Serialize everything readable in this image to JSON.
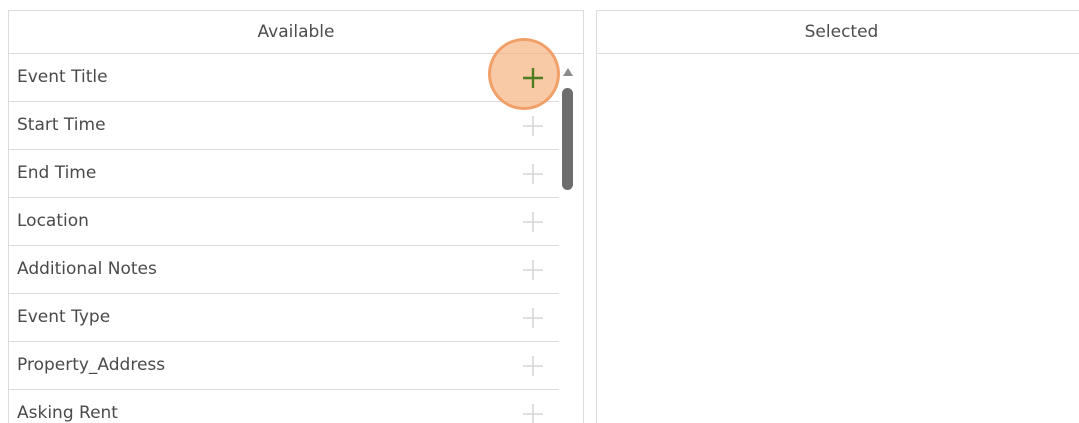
{
  "available_panel": {
    "header": "Available",
    "items": [
      {
        "label": "Event Title",
        "add_icon": "plus-icon",
        "active": true
      },
      {
        "label": "Start Time",
        "add_icon": "plus-icon",
        "active": false
      },
      {
        "label": "End Time",
        "add_icon": "plus-icon",
        "active": false
      },
      {
        "label": "Location",
        "add_icon": "plus-icon",
        "active": false
      },
      {
        "label": "Additional Notes",
        "add_icon": "plus-icon",
        "active": false
      },
      {
        "label": "Event Type",
        "add_icon": "plus-icon",
        "active": false
      },
      {
        "label": "Property_Address",
        "add_icon": "plus-icon",
        "active": false
      },
      {
        "label": "Asking Rent",
        "add_icon": "plus-icon",
        "active": false
      }
    ]
  },
  "selected_panel": {
    "header": "Selected",
    "items": []
  },
  "colors": {
    "active_plus": "#4f7d1f",
    "inactive_plus": "#d6d6d6",
    "highlight": "#f6ad76",
    "border": "#dcdcdc",
    "scroll_thumb": "#6d6d6d"
  }
}
